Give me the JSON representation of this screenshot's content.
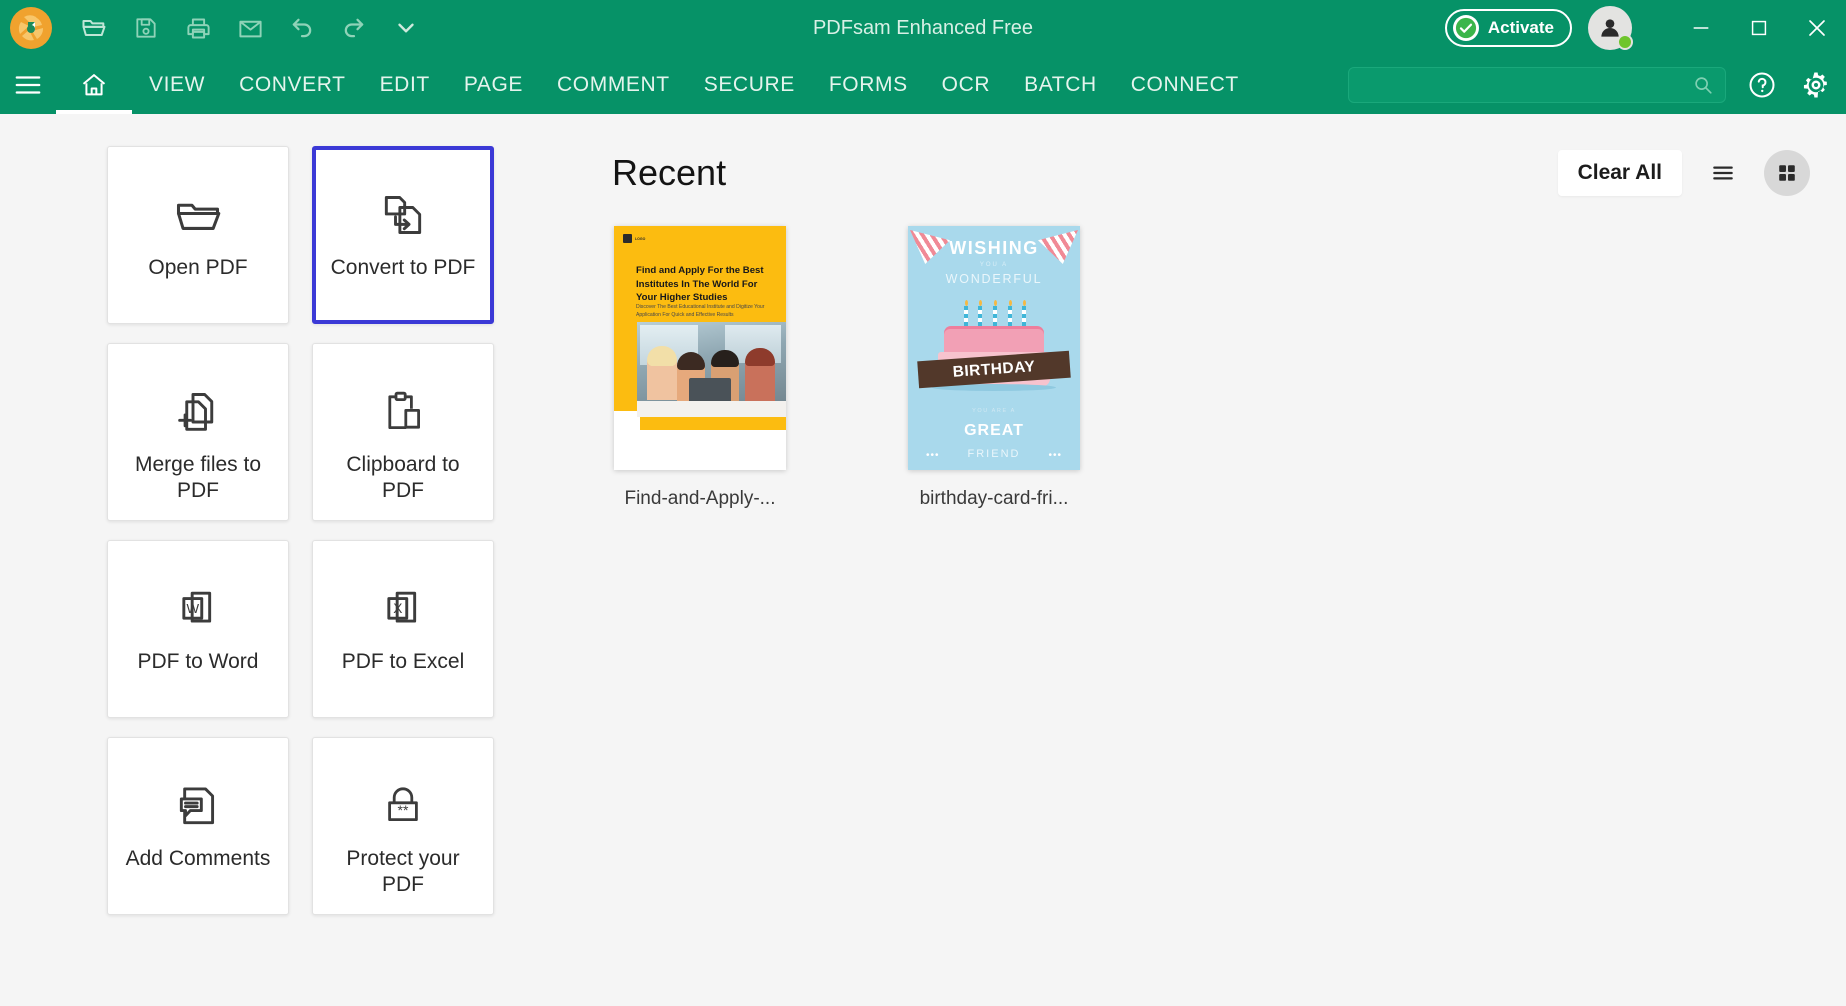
{
  "app": {
    "title": "PDFsam Enhanced Free",
    "accent_color": "#069267",
    "selection_color": "#3b39d6"
  },
  "titlebar": {
    "logo_name": "pdfsam-logo",
    "quick_access": [
      {
        "name": "open-folder-icon",
        "label": "Open"
      },
      {
        "name": "save-icon",
        "label": "Save"
      },
      {
        "name": "print-icon",
        "label": "Print"
      },
      {
        "name": "email-icon",
        "label": "Email"
      },
      {
        "name": "undo-icon",
        "label": "Undo"
      },
      {
        "name": "redo-icon",
        "label": "Redo"
      },
      {
        "name": "chevron-down-icon",
        "label": "Customize"
      }
    ],
    "activate_label": "Activate",
    "window_controls": [
      {
        "name": "minimize-button",
        "glyph": "—"
      },
      {
        "name": "maximize-button",
        "glyph": "□"
      },
      {
        "name": "close-button",
        "glyph": "✕"
      }
    ]
  },
  "menubar": {
    "hamburger_label": "Menu",
    "home_label": "Home",
    "tabs": [
      {
        "label": "VIEW"
      },
      {
        "label": "CONVERT"
      },
      {
        "label": "EDIT"
      },
      {
        "label": "PAGE"
      },
      {
        "label": "COMMENT"
      },
      {
        "label": "SECURE"
      },
      {
        "label": "FORMS"
      },
      {
        "label": "OCR"
      },
      {
        "label": "BATCH"
      },
      {
        "label": "CONNECT"
      }
    ],
    "active_tab": "Home",
    "search": {
      "value": "",
      "placeholder": ""
    },
    "help_label": "Help",
    "settings_label": "Settings"
  },
  "tools": [
    {
      "label": "Open PDF",
      "icon": "open-folder-icon",
      "selected": false
    },
    {
      "label": "Convert to PDF",
      "icon": "convert-to-pdf-icon",
      "selected": true
    },
    {
      "label": "Merge files to PDF",
      "icon": "merge-files-icon",
      "selected": false
    },
    {
      "label": "Clipboard to PDF",
      "icon": "clipboard-icon",
      "selected": false
    },
    {
      "label": "PDF to Word",
      "icon": "word-document-icon",
      "selected": false
    },
    {
      "label": "PDF to Excel",
      "icon": "excel-document-icon",
      "selected": false
    },
    {
      "label": "Add Comments",
      "icon": "comment-document-icon",
      "selected": false
    },
    {
      "label": "Protect your PDF",
      "icon": "lock-icon",
      "selected": false
    }
  ],
  "recent": {
    "title": "Recent",
    "clear_all_label": "Clear All",
    "list_view_label": "List view",
    "grid_view_label": "Grid view",
    "active_view": "grid",
    "items": [
      {
        "name": "Find-and-Apply-...",
        "thumb": {
          "kind": "study-flyer",
          "heading": "Find and Apply For the Best Institutes In The World For Your Higher Studies",
          "subheading": "Discover The Best Educational Institute and Digitize Your Application For Quick and Effective Results"
        }
      },
      {
        "name": "birthday-card-fri...",
        "thumb": {
          "kind": "birthday-card",
          "line1": "WISHING",
          "line2": "YOU A",
          "line3": "WONDERFUL",
          "ribbon": "BIRTHDAY",
          "line4": "YOU ARE A",
          "line5": "GREAT",
          "line6": "FRIEND",
          "dots_left": "•••",
          "dots_right": "•••"
        }
      }
    ]
  }
}
